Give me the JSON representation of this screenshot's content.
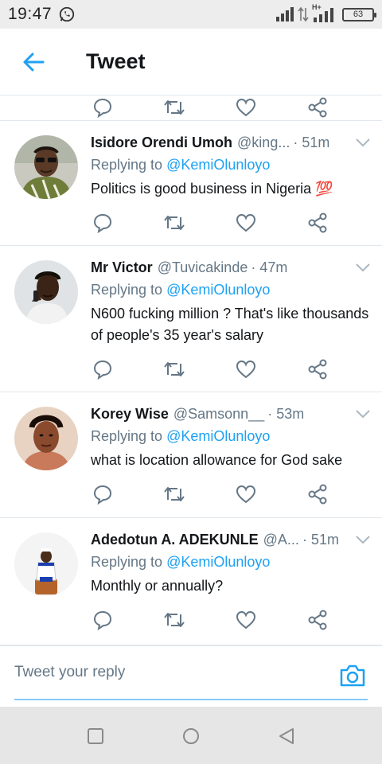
{
  "status_bar": {
    "time": "19:47",
    "network_label": "H+",
    "battery": "63"
  },
  "header": {
    "title": "Tweet"
  },
  "tweets": [
    {
      "name": "Isidore Orendi Umoh",
      "handle": "@king...",
      "time": "· 51m",
      "replying_label": "Replying to",
      "reply_to": "@KemiOlunloyo",
      "text": "Politics is good business in Nigeria 💯"
    },
    {
      "name": "Mr Victor",
      "handle": "@Tuvicakinde",
      "time": "· 47m",
      "replying_label": "Replying to",
      "reply_to": "@KemiOlunloyo",
      "text": "N600 fucking million ? That's like thousands of people's 35 year's salary"
    },
    {
      "name": "Korey Wise",
      "handle": "@Samsonn__",
      "time": "· 53m",
      "replying_label": "Replying to",
      "reply_to": "@KemiOlunloyo",
      "text": "what is location allowance for God sake"
    },
    {
      "name": "Adedotun A. ADEKUNLE",
      "handle": "@A...",
      "time": "· 51m",
      "replying_label": "Replying to",
      "reply_to": "@KemiOlunloyo",
      "text": "Monthly or annually?"
    }
  ],
  "reply_bar": {
    "placeholder": "Tweet your reply"
  },
  "colors": {
    "accent": "#1da1f2",
    "secondary_text": "#657786",
    "icon_gray": "#657786"
  },
  "icons": [
    "back-arrow-icon",
    "reply-icon",
    "retweet-icon",
    "like-icon",
    "share-icon",
    "chevron-down-icon",
    "camera-icon",
    "whatsapp-icon",
    "recent-apps-icon",
    "home-icon",
    "back-icon"
  ]
}
